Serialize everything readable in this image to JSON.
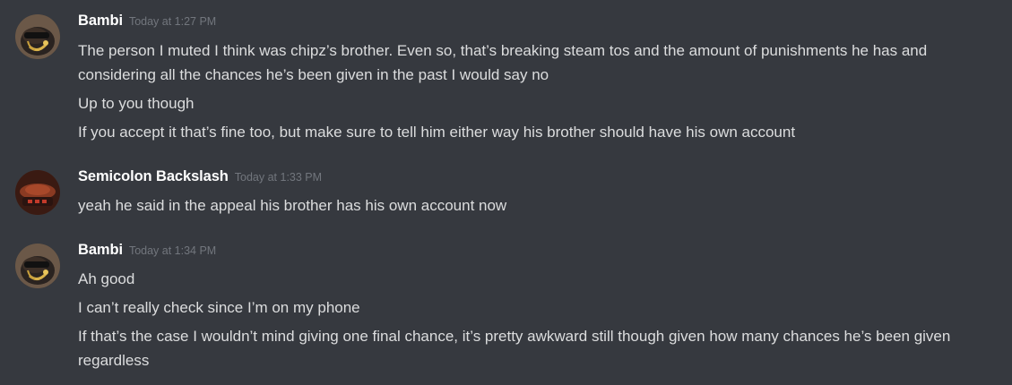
{
  "channel": {
    "messages": [
      {
        "author": "Bambi",
        "timestamp": "Today at 1:27 PM",
        "avatar": "bambi-avatar",
        "lines": [
          "The person I muted I think was chipz’s brother.  Even so, that’s breaking steam tos and the amount of punishments he has and considering all the chances he’s been given in the past I would say no",
          "Up to you though",
          "If you accept it that’s fine too, but make sure to tell him either way his brother should have his own account"
        ]
      },
      {
        "author": "Semicolon Backslash",
        "timestamp": "Today at 1:33 PM",
        "avatar": "semicolon-avatar",
        "lines": [
          "yeah he said in the appeal his brother has his own account now"
        ]
      },
      {
        "author": "Bambi",
        "timestamp": "Today at 1:34 PM",
        "avatar": "bambi-avatar",
        "lines": [
          "Ah good",
          "I can’t really check since I’m on my phone",
          "If that’s the case I wouldn’t mind giving one final chance, it’s pretty awkward still though given how many chances he’s been given regardless"
        ]
      }
    ]
  },
  "colors": {
    "background": "#36393f",
    "username": "#ffffff",
    "timestamp": "#72767d",
    "text": "#dcddde"
  }
}
